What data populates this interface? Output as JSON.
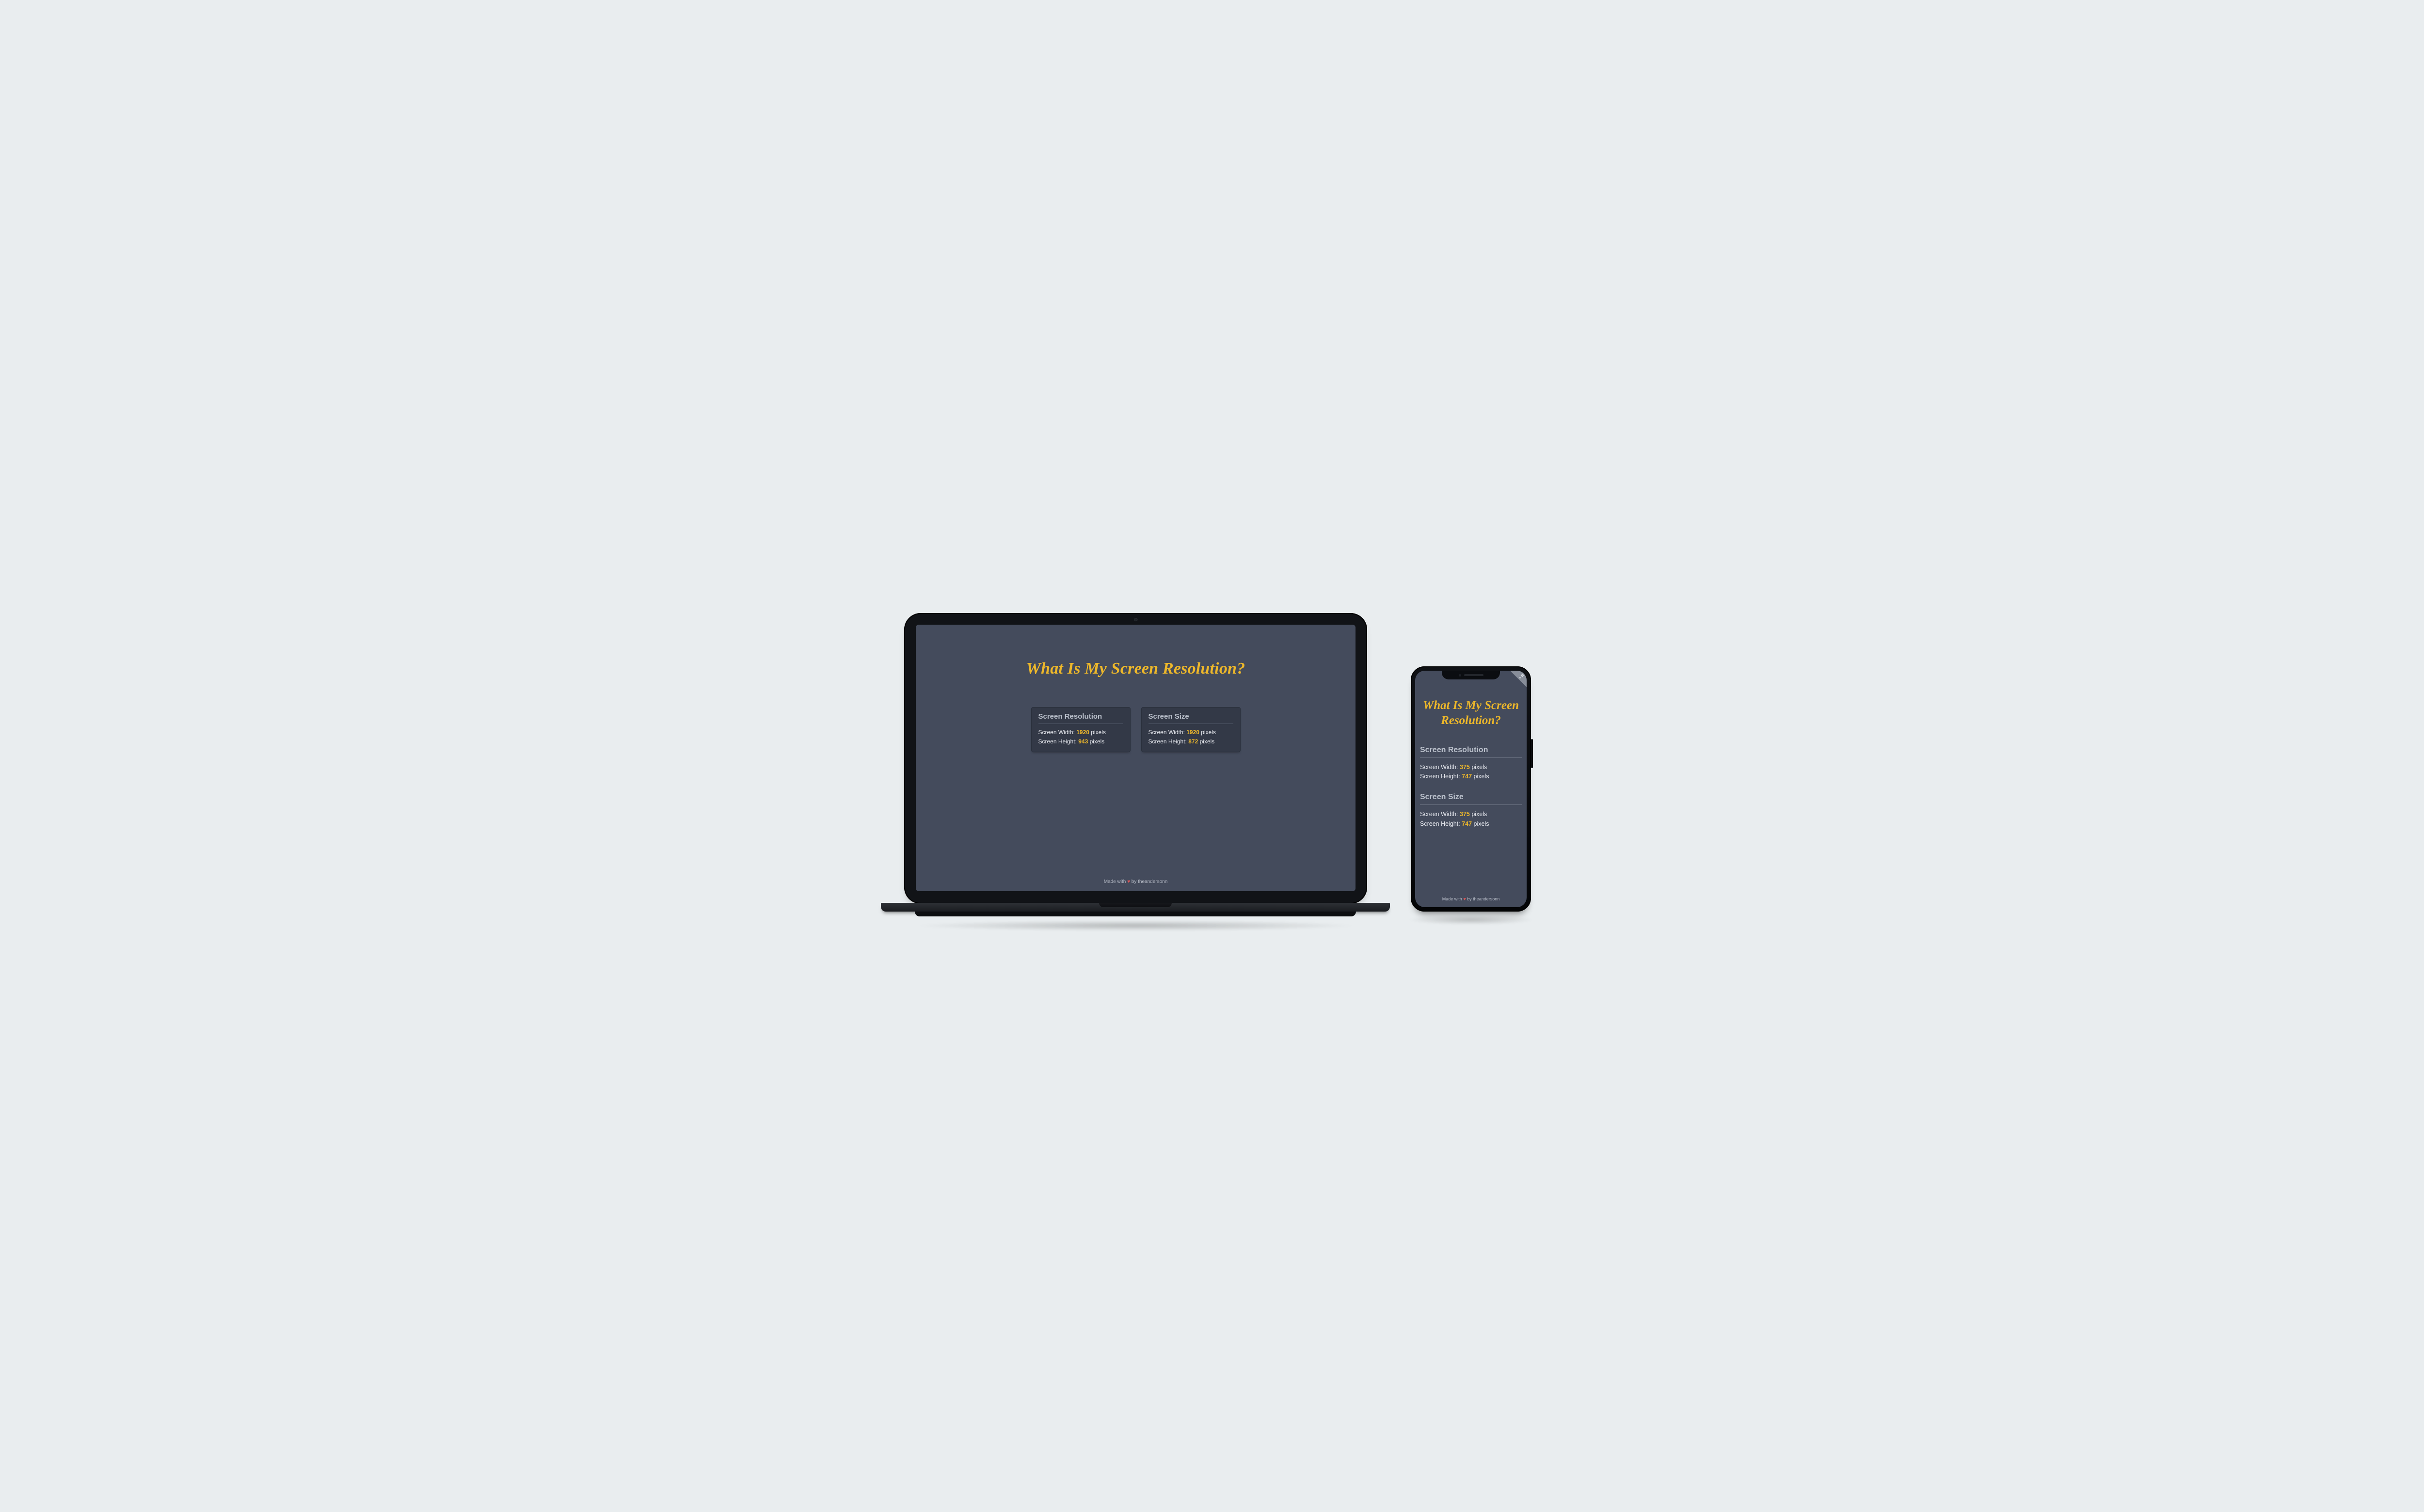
{
  "colors": {
    "bg_app": "#444b5c",
    "accent": "#eeb82a",
    "heart": "#e25858",
    "card": "#333947"
  },
  "title": "What Is My Screen Resolution?",
  "labels": {
    "resolution_heading": "Screen Resolution",
    "size_heading": "Screen Size",
    "width_label": "Screen Width:",
    "height_label": "Screen Height:",
    "unit": "pixels"
  },
  "laptop": {
    "resolution": {
      "width": "1920",
      "height": "943"
    },
    "size": {
      "width": "1920",
      "height": "872"
    }
  },
  "phone": {
    "resolution": {
      "width": "375",
      "height": "747"
    },
    "size": {
      "width": "375",
      "height": "747"
    }
  },
  "footer": {
    "prefix": "Made with",
    "heart": "♥",
    "suffix": "by theandersonn"
  },
  "icons": {
    "phone_corner": "plug-icon"
  }
}
